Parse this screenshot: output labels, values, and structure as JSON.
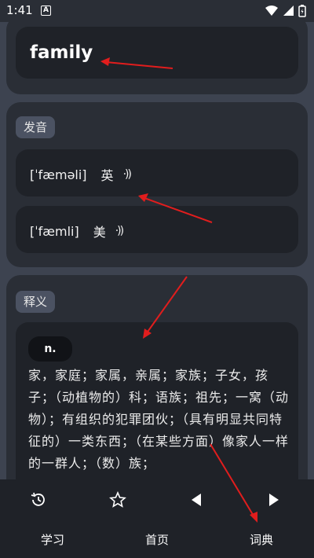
{
  "status": {
    "time": "1:41",
    "notif": "A"
  },
  "word": "family",
  "pron_section": {
    "tag": "发音",
    "items": [
      {
        "ipa": "[ˈfæməli]",
        "lang": "英"
      },
      {
        "ipa": "[ˈfæmli]",
        "lang": "美"
      }
    ]
  },
  "def_section": {
    "tag": "释义",
    "pos": "n.",
    "text": "家，家庭；家属，亲属；家族；子女，孩子；（动植物的）科；语族；祖先；一窝（动物）；有组织的犯罪团伙；（具有明显共同特征的）一类东西；（在某些方面）像家人一样的一群人；（数）族；"
  },
  "bottom": {
    "tabs": [
      {
        "label": "学习"
      },
      {
        "label": "首页"
      },
      {
        "label": "词典"
      }
    ]
  },
  "colors": {
    "annotation": "#e11d1d"
  }
}
